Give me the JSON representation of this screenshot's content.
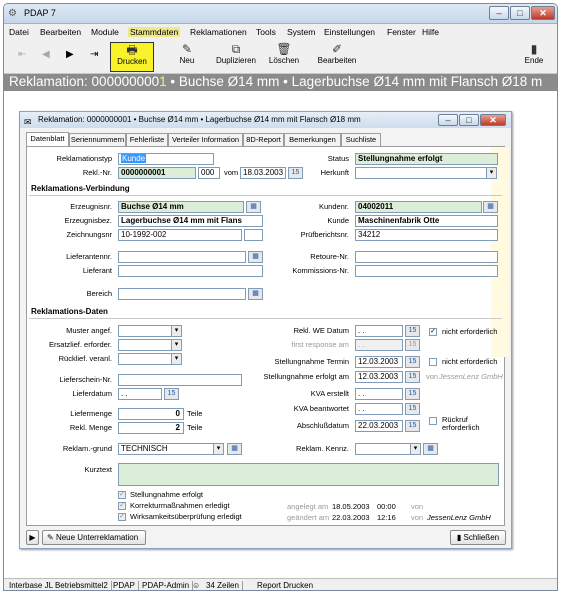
{
  "app": {
    "title": "PDAP 7"
  },
  "window_controls": {
    "minimize": "–",
    "maximize": "□",
    "close": "✕"
  },
  "menu": [
    "Datei",
    "Bearbeiten",
    "Module",
    "Stammdaten",
    "Reklamationen",
    "Tools",
    "System",
    "Einstellungen",
    "Fenster",
    "Hilfe"
  ],
  "toolbar": {
    "drucken": "Drucken",
    "neu": "Neu",
    "duplizieren": "Duplizieren",
    "loeschen": "Löschen",
    "bearbeiten": "Bearbeiten",
    "ende": "Ende",
    "icons": {
      "first": "⇤",
      "prev": "◀",
      "next": "▶",
      "last": "⇥"
    }
  },
  "header": {
    "prefix": "Reklamation:  ",
    "number_plain": "000000000",
    "number_highlight": "1",
    "rest": " • Buchse Ø14 mm • Lagerbuchse Ø14 mm mit Flansch Ø18 m"
  },
  "inner": {
    "title": "Reklamation: 0000000001 • Buchse Ø14 mm • Lagerbuchse Ø14 mm mit Flansch Ø18 mm",
    "tabs": [
      "Datenblatt",
      "Seriennummern",
      "Fehlerliste",
      "Verteiler Information",
      "8D-Report",
      "Bemerkungen",
      "Suchliste"
    ],
    "form": {
      "reklamationstyp_label": "Reklamationstyp",
      "reklamationstyp": "Kunde",
      "rekl_nr_label": "Rekl.-Nr.",
      "rekl_nr": "0000000001",
      "rekl_sub": "000",
      "vom_label": "vom",
      "vom": "18.03.2003",
      "status_label": "Status",
      "status": "Stellungnahme erfolgt",
      "herkunft_label": "Herkunft",
      "herkunft": "",
      "section_verbindung": "Reklamations-Verbindung",
      "erzeugnisnr_label": "Erzeugnisnr.",
      "erzeugnisnr": "Buchse Ø14 mm",
      "erzeugnisbez_label": "Erzeugnisbez.",
      "erzeugnisbez": "Lagerbuchse Ø14 mm mit Flans",
      "zeichnungsnr_label": "Zeichnungsnr",
      "zeichnungsnr": "10-1992-002",
      "kundennr_label": "Kundenr.",
      "kundennr": "04002011",
      "kunde_label": "Kunde",
      "kunde": "Maschinenfabrik Otte",
      "pruefbericht_label": "Prüfberichtsnr.",
      "pruefbericht": "34212",
      "lieferantennr_label": "Lieferantennr.",
      "lieferant_label": "Lieferant",
      "retoure_label": "Retoure-Nr.",
      "kommission_label": "Kommissions-Nr.",
      "bereich_label": "Bereich",
      "section_daten": "Reklamations-Daten",
      "muster_label": "Muster angef.",
      "ersatz_label": "Ersatzlief. erforder.",
      "rueck_label": "Rücklief. veranl.",
      "lieferschein_label": "Lieferschein-Nr.",
      "lieferdatum_label": "Lieferdatum",
      "lieferdatum": ". .",
      "liefermenge_label": "Liefermenge",
      "liefermenge": "0",
      "reklmenge_label": "Rekl. Menge",
      "reklmenge": "2",
      "teile": "Teile",
      "grund_label": "Reklam.-grund",
      "grund": "TECHNISCH",
      "we_datum_label": "Rekl. WE Datum",
      "we_datum": ". .",
      "first_response_label": "first response am",
      "first_response": ". .",
      "termin_label": "Stellungnahme Termin",
      "termin": "12.03.2003",
      "erfolgt_label": "Stellungnahme erfolgt am",
      "erfolgt": "12.03.2003",
      "von_label": "von",
      "von": "JessenLenz GmbH",
      "kva_erstellt_label": "KVA erstellt",
      "kva_erstellt": ". .",
      "kva_beantw_label": "KVA beantwortet",
      "kva_beantw": ". .",
      "abschluss_label": "Abschlußdatum",
      "abschluss": "22.03.2003",
      "kennz_label": "Reklam. Kennz.",
      "nicht_erforderlich_1": "nicht erforderlich",
      "nicht_erforderlich_2": "nicht erforderlich",
      "rueckruf": "Rückruf erforderlich",
      "kurztext_label": "Kurztext",
      "cal": "15",
      "dd": "▾",
      "pick": "▦",
      "checks": [
        {
          "label": "Stellungnahme erfolgt",
          "checked": true
        },
        {
          "label": "Korrekturmaßnahmen erledigt",
          "checked": true
        },
        {
          "label": "Wirksamkeitsüberprüfung erledigt",
          "checked": true
        }
      ],
      "angelegt_label": "angelegt am",
      "angelegt_date": "18.05.2003",
      "angelegt_time": "00:00",
      "angelegt_von_label": "von",
      "angelegt_von": "",
      "geaendert_label": "geändert am",
      "geaendert_date": "22.03.2003",
      "geaendert_time": "12:16",
      "geaendert_von_label": "von",
      "geaendert_von": "JessenLenz GmbH"
    },
    "buttons": {
      "arrow": "▶",
      "neue": "Neue Unterreklamation",
      "schliessen": "Schließen"
    }
  },
  "statusbar": [
    "Interbase JL Betriebsmittel2",
    "PDAP",
    "PDAP-Admin",
    "34 Zeilen",
    "Report Drucken"
  ]
}
